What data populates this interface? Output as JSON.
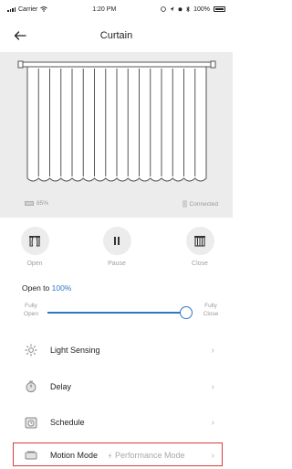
{
  "status_bar": {
    "carrier": "Carrier",
    "time": "1:20 PM",
    "battery": "100%"
  },
  "nav": {
    "title": "Curtain",
    "back_icon": "arrow-left-icon"
  },
  "device": {
    "battery_level": "85%",
    "connection": "Connected"
  },
  "controls": [
    {
      "label": "Open",
      "icon": "curtain-open-icon"
    },
    {
      "label": "Pause",
      "icon": "pause-icon"
    },
    {
      "label": "Close",
      "icon": "curtain-close-icon"
    }
  ],
  "position": {
    "prefix": "Open to",
    "value": "100%",
    "left_label_1": "Fully",
    "left_label_2": "Open",
    "right_label_1": "Fully",
    "right_label_2": "Close",
    "fraction": 1.0
  },
  "menu": {
    "light_sensing": "Light Sensing",
    "delay": "Delay",
    "schedule": "Schedule",
    "motion_mode": "Motion Mode",
    "motion_mode_value": "Performance Mode"
  },
  "colors": {
    "accent": "#2f78c4",
    "highlight": "#d63c3c",
    "panel": "#ececec"
  }
}
